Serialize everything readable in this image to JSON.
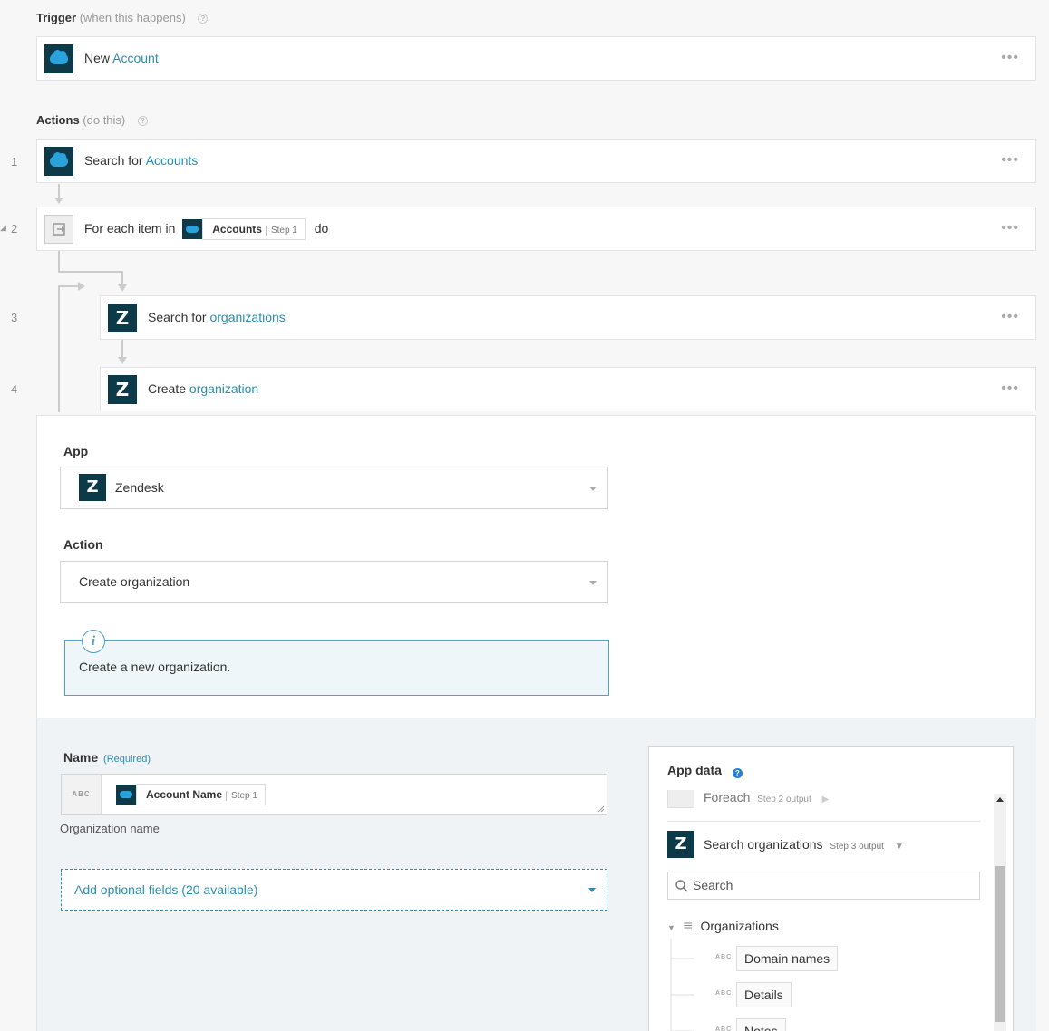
{
  "trigger": {
    "title": "Trigger",
    "subtitle": "(when this happens)",
    "card": {
      "prefix": "New",
      "link": "Account"
    }
  },
  "actions": {
    "title": "Actions",
    "subtitle": "(do this)",
    "steps": [
      {
        "num": "1",
        "prefix": "Search for",
        "link": "Accounts"
      },
      {
        "num": "2",
        "prefix": "For each item in",
        "pill_label": "Accounts",
        "pill_step": "Step 1",
        "suffix": "do"
      },
      {
        "num": "3",
        "prefix": "Search for",
        "link": "organizations"
      },
      {
        "num": "4",
        "prefix": "Create",
        "link": "organization"
      }
    ]
  },
  "config": {
    "app_label": "App",
    "app_value": "Zendesk",
    "action_label": "Action",
    "action_value": "Create organization",
    "info_text": "Create a new organization."
  },
  "form": {
    "name_label": "Name",
    "name_required": "(Required)",
    "abc": "ABC",
    "pill_label": "Account Name",
    "pill_step": "Step 1",
    "hint": "Organization name",
    "optional_label": "Add optional fields (20 available)"
  },
  "app_data": {
    "title": "App data",
    "foreach_label": "Foreach",
    "foreach_step": "Step 2 output",
    "search_org_label": "Search organizations",
    "search_org_step": "Step 3 output",
    "search_placeholder": "Search",
    "tree_root": "Organizations",
    "fields": [
      "Domain names",
      "Details",
      "Notes"
    ],
    "abc": "ABC"
  },
  "icons": {
    "salesforce": "salesforce-logo",
    "zendesk": "zendesk-logo",
    "loop": "loop-icon",
    "more": "more-dots-icon",
    "help": "help-icon",
    "info": "info-icon"
  },
  "colors": {
    "link": "#2a8eb0",
    "logo_bg": "#0c3a48",
    "info_border": "#4ea0c4"
  }
}
